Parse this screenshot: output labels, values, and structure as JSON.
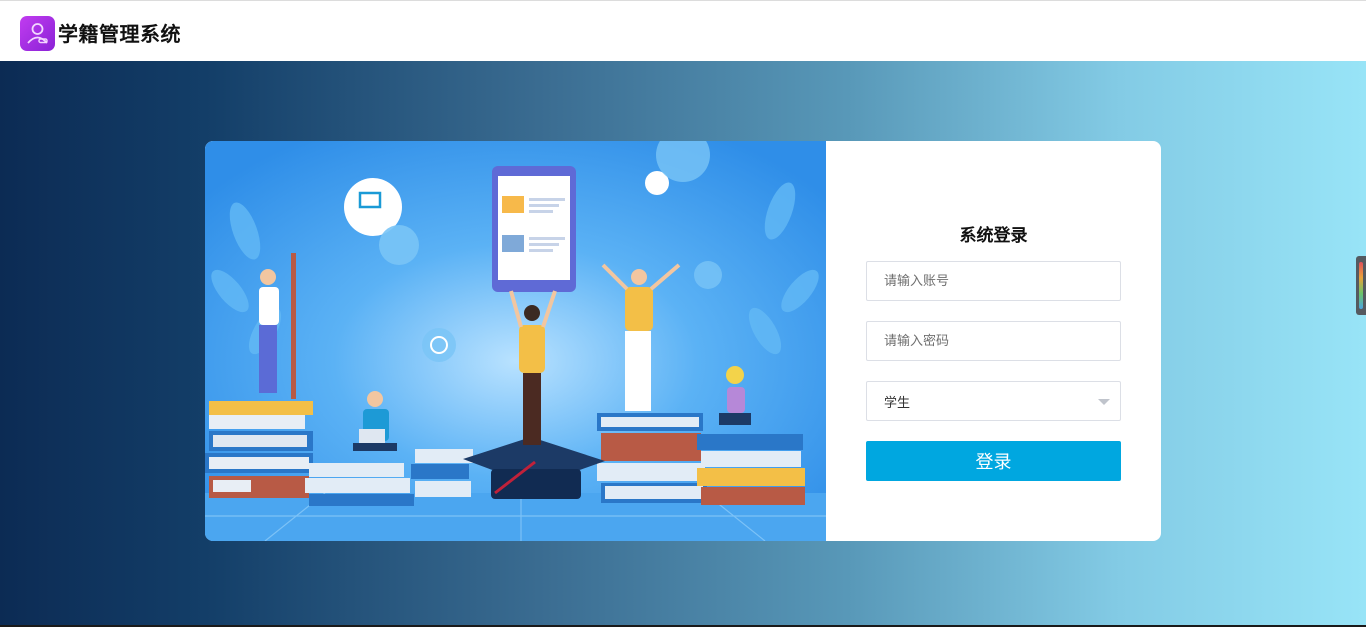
{
  "header": {
    "app_title": "学籍管理系统",
    "logo_icon": "user-badge-icon"
  },
  "colors": {
    "accent": "#00a7e0",
    "logo": "#a12fe0",
    "background_start": "#0c2b54",
    "background_end": "#98e4f7"
  },
  "login": {
    "title": "系统登录",
    "username_placeholder": "请输入账号",
    "password_placeholder": "请输入密码",
    "role_selected": "学生",
    "submit_label": "登录"
  },
  "illustration": {
    "icon": "students-with-books-illustration"
  }
}
